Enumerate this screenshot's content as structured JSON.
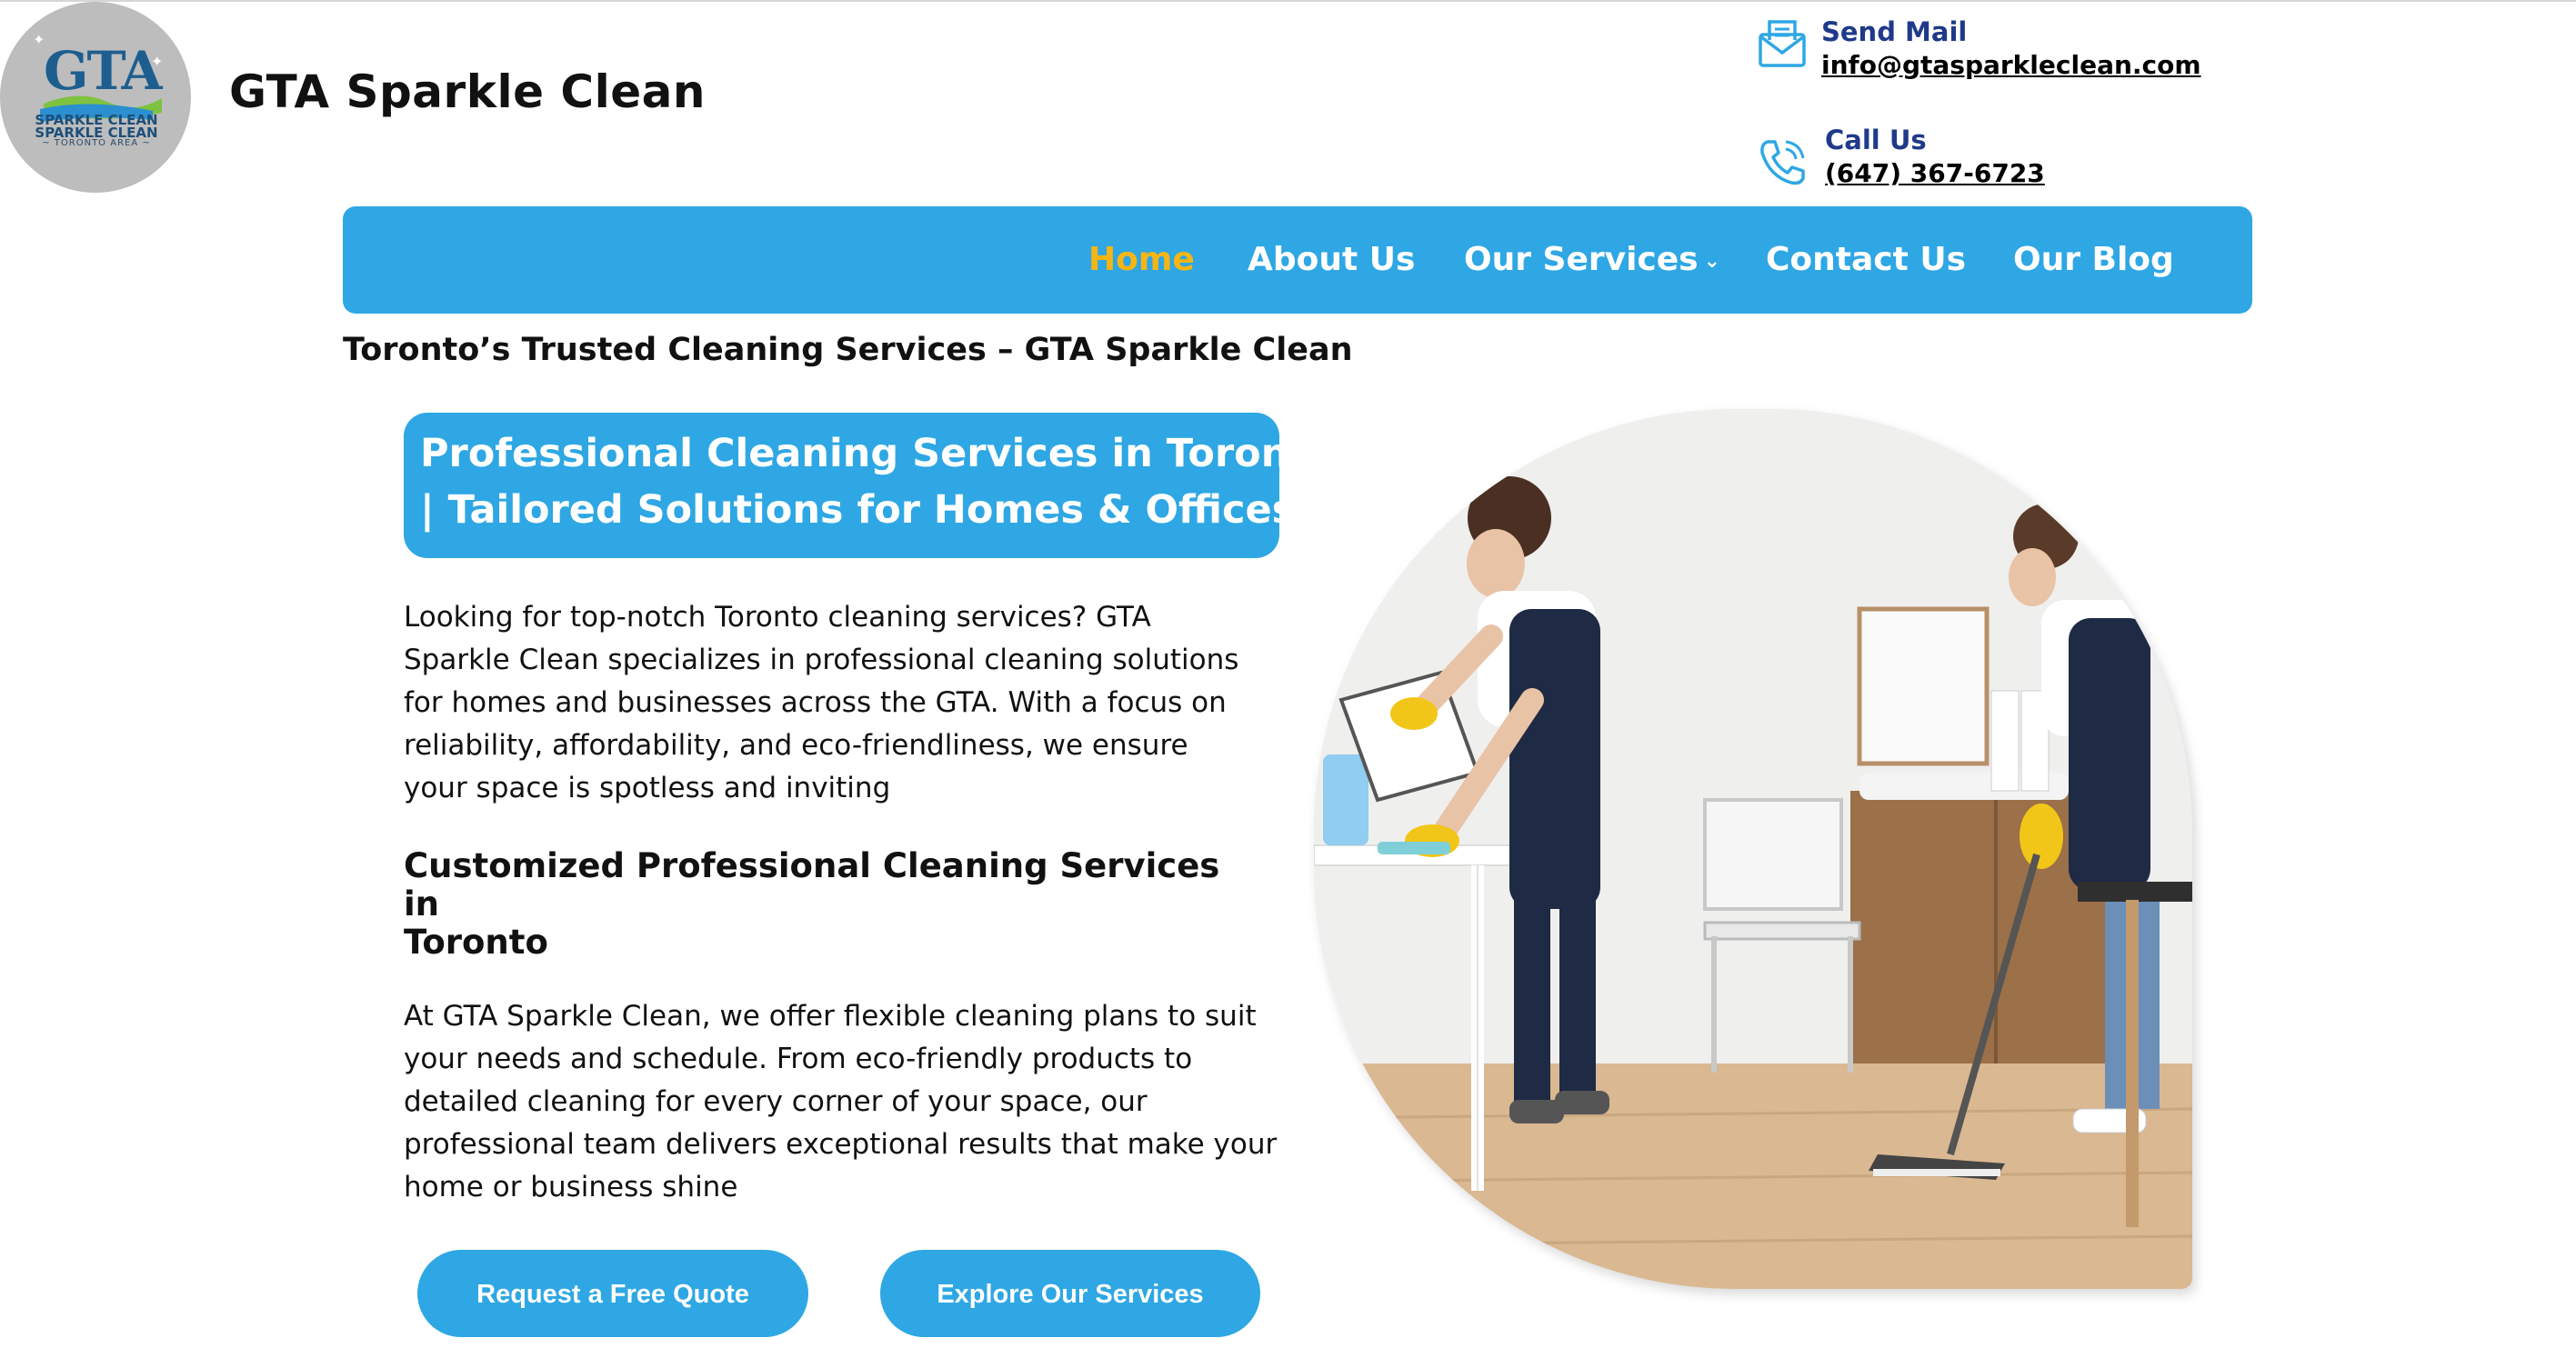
{
  "header": {
    "site_title": "GTA Sparkle Clean",
    "logo": {
      "main_text": "GTA",
      "line1": "SPARKLE CLEAN",
      "line2": "SPARKLE CLEAN",
      "area": "~ TORONTO AREA ~"
    },
    "contact": {
      "mail_label": "Send Mail",
      "mail_value": "info@gtasparkleclean.com",
      "phone_label": "Call Us",
      "phone_value": "(647) 367-6723"
    }
  },
  "nav": {
    "items": [
      {
        "label": "Home",
        "active": true
      },
      {
        "label": "About Us"
      },
      {
        "label": "Our Services",
        "has_dropdown": true
      },
      {
        "label": "Contact Us"
      },
      {
        "label": "Our Blog"
      }
    ]
  },
  "main": {
    "tagline": "Toronto’s Trusted Cleaning Services – GTA Sparkle Clean",
    "hero_title_line1": "Professional Cleaning Services in Toronto",
    "hero_title_line2": "| Tailored Solutions for Homes & Offices",
    "intro_lines": [
      "Looking for top-notch Toronto cleaning services? GTA",
      "Sparkle Clean specializes in professional cleaning solutions",
      "for homes and businesses across the GTA. With a focus on",
      "reliability, affordability, and eco-friendliness, we ensure",
      "your space is spotless and inviting"
    ],
    "subheading_line1": "Customized Professional Cleaning Services in",
    "subheading_line2": "Toronto",
    "body_lines": [
      "At GTA Sparkle Clean, we offer flexible cleaning plans to suit",
      "your needs and schedule. From eco-friendly products to",
      "detailed cleaning for every corner of your space, our",
      "professional team delivers exceptional results that make your",
      "home or business shine"
    ],
    "buttons": {
      "quote": "Request a Free Quote",
      "services": "Explore Our Services"
    }
  },
  "colors": {
    "brand_blue": "#2ea7e4",
    "nav_active": "#f7b513",
    "contact_label": "#1f3a8a"
  }
}
